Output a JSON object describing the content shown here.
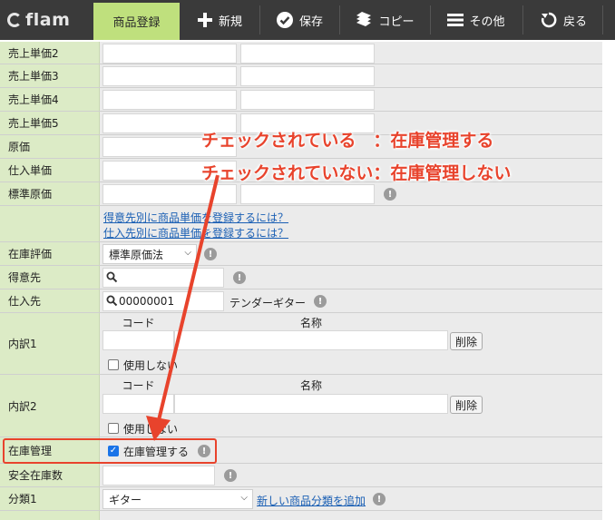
{
  "app": {
    "logo": "flam"
  },
  "toolbar": {
    "active_tab": "商品登録",
    "new_label": "新規",
    "save_label": "保存",
    "copy_label": "コピー",
    "other_label": "その他",
    "back_label": "戻る"
  },
  "form": {
    "sales_price2": "売上単価2",
    "sales_price3": "売上単価3",
    "sales_price4": "売上単価4",
    "sales_price5": "売上単価5",
    "cost": "原価",
    "purchase_price": "仕入単価",
    "standard_cost": "標準原価",
    "customer_price_link": "得意先別に商品単価を登録するには？",
    "supplier_price_link": "仕入先別に商品単価を登録するには？",
    "inventory_valuation": {
      "label": "在庫評価",
      "value": "標準原価法"
    },
    "customer": {
      "label": "得意先",
      "value": ""
    },
    "supplier": {
      "label": "仕入先",
      "code": "00000001",
      "name": "テンダーギター"
    },
    "breakdown1": {
      "label": "内訳1",
      "code_header": "コード",
      "name_header": "名称",
      "delete": "削除",
      "unused": "使用しない"
    },
    "breakdown2": {
      "label": "内訳2",
      "code_header": "コード",
      "name_header": "名称",
      "delete": "削除",
      "unused": "使用しない"
    },
    "inventory_management": {
      "label": "在庫管理",
      "checkbox_label": "在庫管理する",
      "checked": true
    },
    "safety_stock": {
      "label": "安全在庫数"
    },
    "category1": {
      "label": "分類1",
      "value": "ギター",
      "add_link": "新しい商品分類を追加"
    }
  },
  "annotation": {
    "line1": "チェックされている　：在庫管理する",
    "line2": "チェックされていない：在庫管理しない",
    "color": "#e8432c"
  }
}
